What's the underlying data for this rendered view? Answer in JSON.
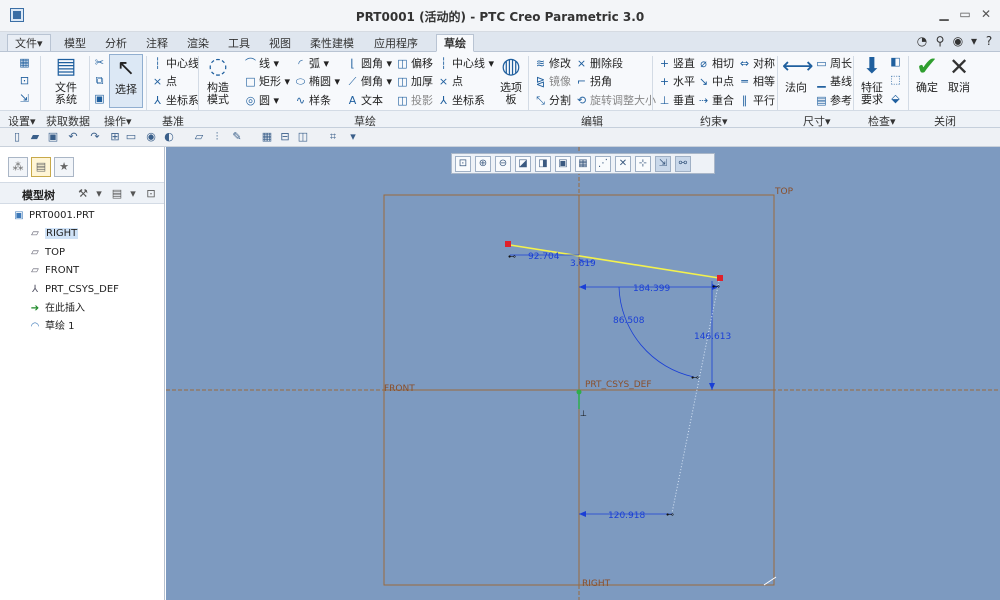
{
  "window": {
    "title": "PRT0001 (活动的) - PTC Creo Parametric 3.0"
  },
  "tabs": [
    {
      "label": "文件▾"
    },
    {
      "label": "模型"
    },
    {
      "label": "分析"
    },
    {
      "label": "注释"
    },
    {
      "label": "渲染"
    },
    {
      "label": "工具"
    },
    {
      "label": "视图"
    },
    {
      "label": "柔性建模"
    },
    {
      "label": "应用程序"
    },
    {
      "label": "草绘"
    }
  ],
  "ribbon": {
    "setup": {
      "file_system": "文件\n系统",
      "group": "设置▾"
    },
    "getdata": {
      "group": "获取数据"
    },
    "operations": {
      "select": "选择",
      "group": "操作▾"
    },
    "datum": {
      "centerline": "中心线",
      "point": "点",
      "csys": "坐标系",
      "group": "基准"
    },
    "sketch": {
      "construction": "构造\n模式",
      "line": "线",
      "arc": "弧",
      "fillet": "圆角",
      "offset": "偏移",
      "centerline": "中心线",
      "rectangle": "矩形",
      "ellipse": "椭圆",
      "chamfer": "倒角",
      "thicken": "加厚",
      "point": "点",
      "circle": "圆",
      "spline": "样条",
      "text": "文本",
      "project": "投影",
      "csys": "坐标系",
      "palette": "选项\n板",
      "group": "草绘"
    },
    "editing": {
      "modify": "修改",
      "delete_segment": "删除段",
      "mirror": "镜像",
      "corner": "拐角",
      "divide": "分割",
      "rotate_resize": "旋转调整大小",
      "group": "编辑"
    },
    "constrain": {
      "vertical": "竖直",
      "tangent": "相切",
      "symmetric": "对称",
      "horizontal": "水平",
      "midpoint": "中点",
      "equal": "相等",
      "perpendicular": "垂直",
      "coincident": "重合",
      "parallel": "平行",
      "group": "约束▾"
    },
    "dimension": {
      "normal": "法向",
      "perimeter": "周长",
      "baseline": "基线",
      "reference": "参考",
      "group": "尺寸▾"
    },
    "inspect": {
      "feature_req": "特征\n要求",
      "group": "检查▾"
    },
    "close": {
      "ok": "确定",
      "cancel": "取消",
      "group": "关闭"
    }
  },
  "model_tree": {
    "title": "模型树",
    "items": [
      {
        "label": "PRT0001.PRT",
        "icon": "part-icon"
      },
      {
        "label": "RIGHT",
        "icon": "datum-plane-icon",
        "selected": true
      },
      {
        "label": "TOP",
        "icon": "datum-plane-icon"
      },
      {
        "label": "FRONT",
        "icon": "datum-plane-icon"
      },
      {
        "label": "PRT_CSYS_DEF",
        "icon": "csys-icon"
      },
      {
        "label": "在此插入",
        "icon": "insert-arrow-icon"
      },
      {
        "label": "草绘 1",
        "icon": "sketch-icon"
      }
    ]
  },
  "sketch": {
    "datum_labels": {
      "top": "TOP",
      "front": "FRONT",
      "right": "RIGHT",
      "csys": "PRT_CSYS_DEF"
    },
    "dimensions": {
      "left_horizontal": "92.704",
      "angle_small": "3.619",
      "right_horizontal": "184.399",
      "arc_angle": "86.508",
      "vertical": "146.613",
      "bottom_horizontal": "120.918"
    }
  },
  "colors": {
    "graphics_bg": "#7d9ac0",
    "sketch_line": "#f4f24c",
    "dimension": "#1a3fd6",
    "datum": "#9a6a3c",
    "endpoint": "#e0202a",
    "ok_check": "#2f9e2f"
  }
}
